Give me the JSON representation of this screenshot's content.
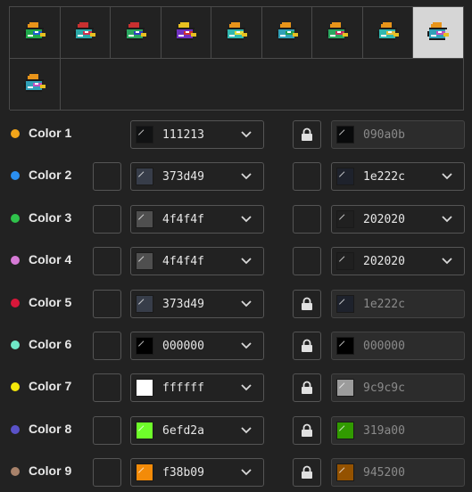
{
  "sprites": [
    {
      "icon": "duck-sprite-1",
      "hat": "#e8941a",
      "body": "#1fa84a",
      "band": "#2060d0"
    },
    {
      "icon": "duck-sprite-2",
      "hat": "#c83030",
      "body": "#2aa8a8",
      "band": "#d03050"
    },
    {
      "icon": "duck-sprite-3",
      "hat": "#c83030",
      "body": "#2aa860",
      "band": "#3040c0"
    },
    {
      "icon": "duck-sprite-4",
      "hat": "#e8c020",
      "body": "#7030c0",
      "band": "#d03030"
    },
    {
      "icon": "duck-sprite-5",
      "hat": "#e8941a",
      "body": "#30b8b0",
      "band": "#e0e040"
    },
    {
      "icon": "duck-sprite-6",
      "hat": "#e8941a",
      "body": "#30a0b8",
      "band": "#20a050"
    },
    {
      "icon": "duck-sprite-7",
      "hat": "#e8941a",
      "body": "#2aa860",
      "band": "#c83060"
    },
    {
      "icon": "duck-sprite-8",
      "hat": "#e8941a",
      "body": "#30b8b0",
      "band": "#e0c040"
    },
    {
      "icon": "duck-sprite-9",
      "hat": "#e8941a",
      "body": "#30a0b8",
      "band": "#c050c0",
      "selected": true
    },
    {
      "icon": "duck-sprite-10",
      "hat": "#e8941a",
      "body": "#30a0b8",
      "band": "#c050c0"
    }
  ],
  "colors": [
    {
      "label": "Color 1",
      "dot": "#f2a51a",
      "source": "111213",
      "target": "090a0b",
      "locked": true,
      "has_box": false
    },
    {
      "label": "Color 2",
      "dot": "#2b8ff0",
      "source": "373d49",
      "target": "1e222c",
      "locked": false,
      "has_box": true
    },
    {
      "label": "Color 3",
      "dot": "#2fc24b",
      "source": "4f4f4f",
      "target": "202020",
      "locked": false,
      "has_box": true
    },
    {
      "label": "Color 4",
      "dot": "#d67ad6",
      "source": "4f4f4f",
      "target": "202020",
      "locked": false,
      "has_box": true
    },
    {
      "label": "Color 5",
      "dot": "#d8173a",
      "source": "373d49",
      "target": "1e222c",
      "locked": true,
      "has_box": true
    },
    {
      "label": "Color 6",
      "dot": "#6fe8c8",
      "source": "000000",
      "target": "000000",
      "locked": true,
      "has_box": true
    },
    {
      "label": "Color 7",
      "dot": "#f4e80a",
      "source": "ffffff",
      "target": "9c9c9c",
      "locked": true,
      "has_box": true
    },
    {
      "label": "Color 8",
      "dot": "#5a52c8",
      "source": "6efd2a",
      "target": "319a00",
      "locked": true,
      "has_box": true
    },
    {
      "label": "Color 9",
      "dot": "#a8826a",
      "source": "f38b09",
      "target": "945200",
      "locked": true,
      "has_box": true
    }
  ]
}
